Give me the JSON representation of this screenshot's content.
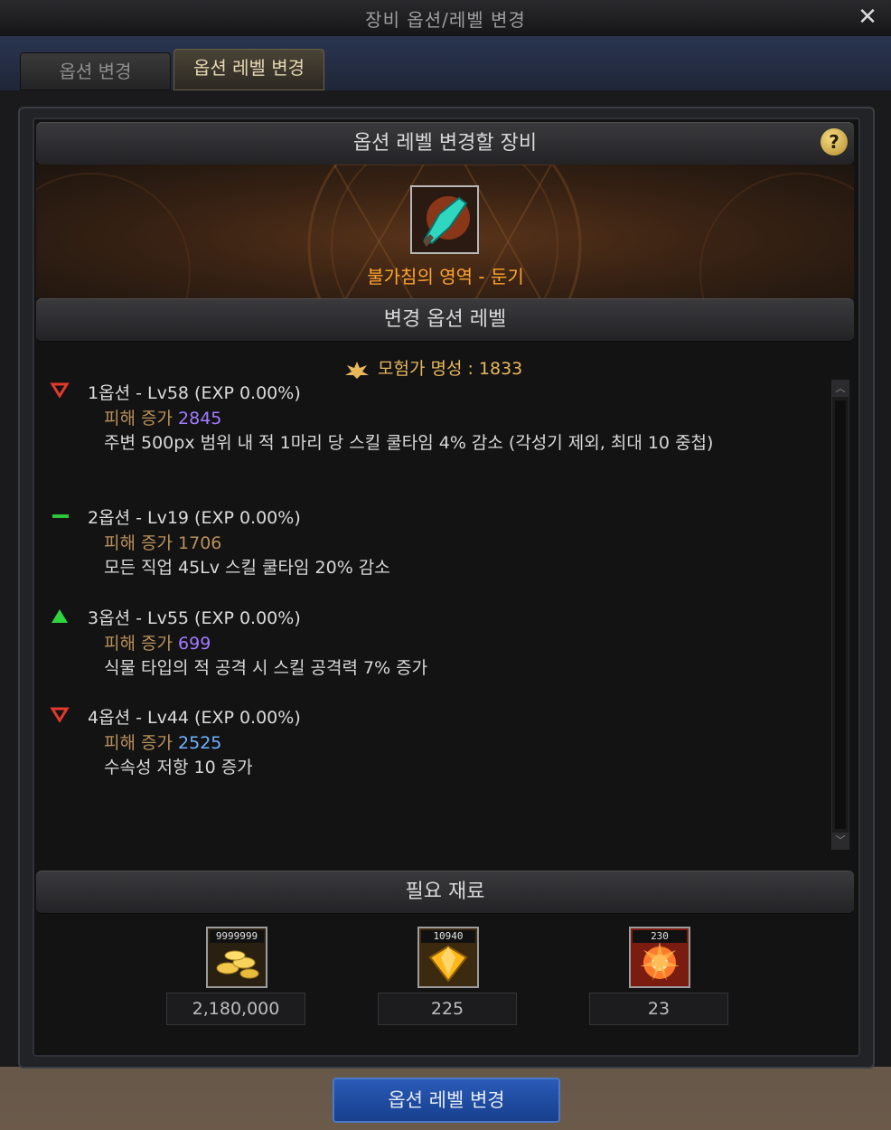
{
  "window": {
    "title": "장비 옵션/레벨 변경"
  },
  "tabs": [
    {
      "label": "옵션 변경",
      "active": false
    },
    {
      "label": "옵션 레벨 변경",
      "active": true
    }
  ],
  "equip_section": {
    "header": "옵션 레벨 변경할 장비",
    "item_name": "불가침의 영역 - 둔기",
    "item_icon": "weapon-blade-icon"
  },
  "option_section": {
    "header": "변경 옵션 레벨",
    "fame_text": "모험가 명성 : 1833",
    "options": [
      {
        "arrow": "down",
        "title": "1옵션 - Lv58 (EXP 0.00%)",
        "dmg_label": "피해 증가",
        "dmg_value": "2845",
        "dmg_color": "#a27bff",
        "desc": "주변 500px 범위 내 적 1마리 당 스킬 쿨타임 4% 감소 (각성기 제외, 최대 10 중첩)"
      },
      {
        "arrow": "flat",
        "title": "2옵션 - Lv19 (EXP 0.00%)",
        "dmg_label": "피해 증가",
        "dmg_value": "1706",
        "dmg_color": "#b99059",
        "desc": "모든 직업 45Lv 스킬 쿨타임 20% 감소"
      },
      {
        "arrow": "up",
        "title": "3옵션 - Lv55 (EXP 0.00%)",
        "dmg_label": "피해 증가",
        "dmg_value": "699",
        "dmg_color": "#a27bff",
        "desc": "식물 타입의 적 공격 시 스킬 공격력 7% 증가"
      },
      {
        "arrow": "down",
        "title": "4옵션 - Lv44 (EXP 0.00%)",
        "dmg_label": "피해 증가",
        "dmg_value": "2525",
        "dmg_color": "#6fb4ff",
        "desc": "수속성 저항 10 증가"
      }
    ]
  },
  "materials_section": {
    "header": "필요 재료",
    "items": [
      {
        "count": "9999999",
        "value": "2,180,000",
        "icon": "gold-coins-icon"
      },
      {
        "count": "10940",
        "value": "225",
        "icon": "gem-icon"
      },
      {
        "count": "230",
        "value": "23",
        "icon": "burst-icon"
      }
    ]
  },
  "action_button": {
    "label": "옵션 레벨 변경"
  },
  "colors": {
    "arrow_down": "#e2392b",
    "arrow_flat": "#29c53b",
    "arrow_up": "#2fd53e",
    "item_name": "#ffa432",
    "fame": "#e8b75c"
  }
}
